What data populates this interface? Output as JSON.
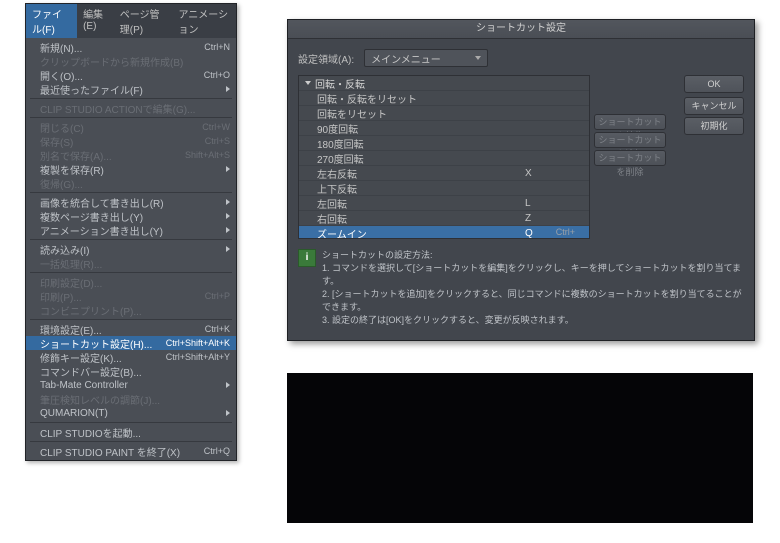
{
  "menubar": {
    "items": [
      {
        "label": "ファイル(F)",
        "active": true
      },
      {
        "label": "編集(E)"
      },
      {
        "label": "ページ管理(P)"
      },
      {
        "label": "アニメーション"
      }
    ]
  },
  "fileMenu": {
    "rows": [
      {
        "label": "新規(N)...",
        "shortcut": "Ctrl+N",
        "arrow": false,
        "disabled": false
      },
      {
        "label": "クリップボードから新規作成(B)",
        "disabled": true
      },
      {
        "label": "開く(O)...",
        "shortcut": "Ctrl+O"
      },
      {
        "label": "最近使ったファイル(F)",
        "arrow": true
      },
      {
        "sep": true
      },
      {
        "label": "CLIP STUDIO ACTIONで編集(G)...",
        "disabled": true
      },
      {
        "sep": true
      },
      {
        "label": "閉じる(C)",
        "shortcut": "Ctrl+W",
        "disabled": true
      },
      {
        "label": "保存(S)",
        "shortcut": "Ctrl+S",
        "disabled": true
      },
      {
        "label": "別名で保存(A)...",
        "shortcut": "Shift+Alt+S",
        "disabled": true
      },
      {
        "label": "複製を保存(R)",
        "arrow": true
      },
      {
        "label": "復帰(G)...",
        "disabled": true
      },
      {
        "sep": true
      },
      {
        "label": "画像を統合して書き出し(R)",
        "arrow": true
      },
      {
        "label": "複数ページ書き出し(Y)",
        "arrow": true
      },
      {
        "label": "アニメーション書き出し(Y)",
        "arrow": true
      },
      {
        "sep": true
      },
      {
        "label": "読み込み(I)",
        "arrow": true
      },
      {
        "label": "一括処理(R)...",
        "disabled": true
      },
      {
        "sep": true
      },
      {
        "label": "印刷設定(D)...",
        "disabled": true
      },
      {
        "label": "印刷(P)...",
        "shortcut": "Ctrl+P",
        "disabled": true
      },
      {
        "label": "コンビニプリント(P)...",
        "disabled": true
      },
      {
        "sep": true
      },
      {
        "label": "環境設定(E)...",
        "shortcut": "Ctrl+K"
      },
      {
        "label": "ショートカット設定(H)...",
        "shortcut": "Ctrl+Shift+Alt+K",
        "highlight": true
      },
      {
        "label": "修飾キー設定(K)...",
        "shortcut": "Ctrl+Shift+Alt+Y"
      },
      {
        "label": "コマンドバー設定(B)..."
      },
      {
        "label": "Tab-Mate Controller",
        "arrow": true
      },
      {
        "label": "筆圧検知レベルの調節(J)...",
        "disabled": true
      },
      {
        "label": "QUMARION(T)",
        "arrow": true
      },
      {
        "sep": true
      },
      {
        "label": "CLIP STUDIOを起動..."
      },
      {
        "sep": true
      },
      {
        "label": "CLIP STUDIO PAINT を終了(X)",
        "shortcut": "Ctrl+Q"
      }
    ]
  },
  "dialog": {
    "title": "ショートカット設定",
    "areaLabel": "設定領域(A):",
    "areaValue": "メインメニュー",
    "buttons": {
      "ok": "OK",
      "cancel": "キャンセル",
      "reset": "初期化"
    },
    "scButtons": {
      "edit": "ショートカットを編集",
      "add": "ショートカットを追加",
      "del": "ショートカットを削除"
    },
    "tree": {
      "header": "回転・反転",
      "rows": [
        {
          "label": "回転・反転をリセット",
          "key": ""
        },
        {
          "label": "回転をリセット",
          "key": ""
        },
        {
          "label": "90度回転",
          "key": ""
        },
        {
          "label": "180度回転",
          "key": ""
        },
        {
          "label": "270度回転",
          "key": ""
        },
        {
          "label": "左右反転",
          "key": "X"
        },
        {
          "label": "上下反転",
          "key": ""
        },
        {
          "label": "左回転",
          "key": "L"
        },
        {
          "label": "右回転",
          "key": "Z"
        },
        {
          "label": "ズームイン",
          "key": "Q",
          "selected": true
        }
      ],
      "extraLabel": "Ctrl+"
    },
    "help": {
      "title": "ショートカットの設定方法:",
      "line1": "1. コマンドを選択して[ショートカットを編集]をクリックし、キーを押してショートカットを割り当てます。",
      "line2": "2. [ショートカットを追加]をクリックすると、同じコマンドに複数のショートカットを割り当てることができます。",
      "line3": "3. 設定の終了は[OK]をクリックすると、変更が反映されます。"
    }
  }
}
